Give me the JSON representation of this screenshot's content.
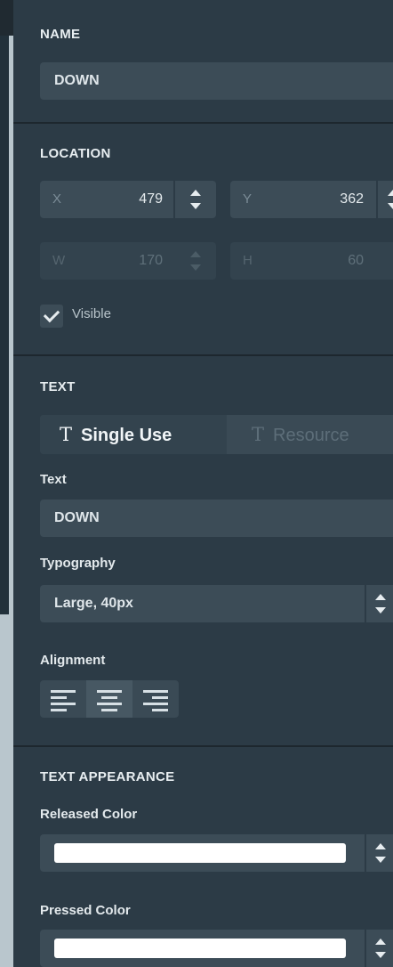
{
  "name_section": {
    "title": "NAME",
    "value": "DOWN"
  },
  "location_section": {
    "title": "LOCATION",
    "x": {
      "label": "X",
      "value": "479"
    },
    "y": {
      "label": "Y",
      "value": "362"
    },
    "w": {
      "label": "W",
      "value": "170"
    },
    "h": {
      "label": "H",
      "value": "60"
    },
    "visible": {
      "label": "Visible",
      "checked": true
    }
  },
  "text_section": {
    "title": "TEXT",
    "source_tabs": [
      {
        "icon": "T",
        "label": "Single Use",
        "active": true
      },
      {
        "icon": "T",
        "label": "Resource",
        "active": false
      }
    ],
    "text_label": "Text",
    "text_value": "DOWN",
    "typography_label": "Typography",
    "typography_value": "Large, 40px",
    "alignment_label": "Alignment",
    "alignment_options": [
      "left",
      "center",
      "right"
    ],
    "alignment_selected": "center"
  },
  "text_appearance_section": {
    "title": "TEXT APPEARANCE",
    "released_color_label": "Released Color",
    "released_color": "#ffffff",
    "pressed_color_label": "Pressed Color",
    "pressed_color": "#ffffff"
  }
}
